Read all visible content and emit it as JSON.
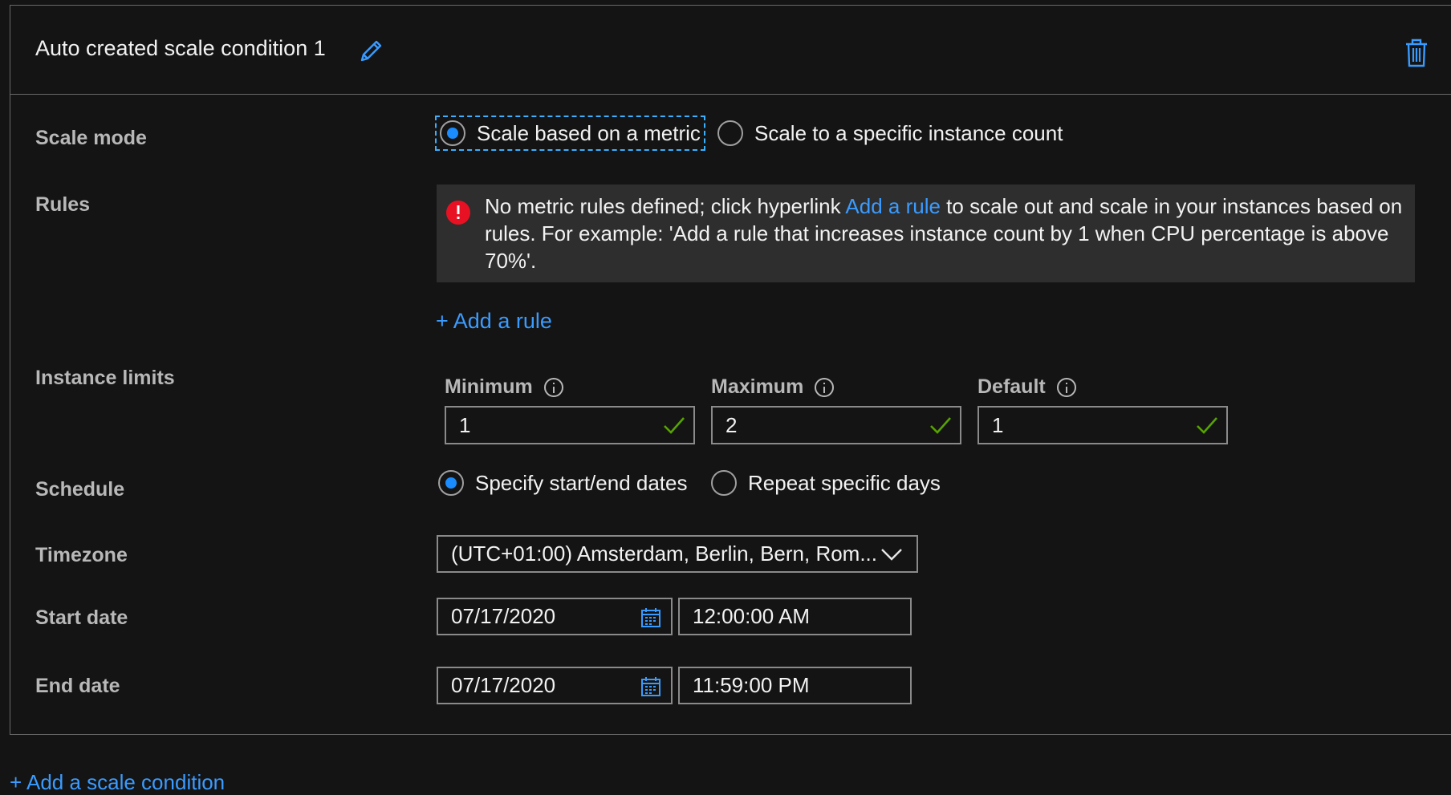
{
  "condition": {
    "title": "Auto created scale condition 1"
  },
  "labels": {
    "scale_mode": "Scale mode",
    "rules": "Rules",
    "instance_limits": "Instance limits",
    "schedule": "Schedule",
    "timezone": "Timezone",
    "start_date": "Start date",
    "end_date": "End date"
  },
  "scale_mode": {
    "option_metric": "Scale based on a metric",
    "option_count": "Scale to a specific instance count",
    "selected": "metric"
  },
  "rules": {
    "message_before": "No metric rules defined; click hyperlink ",
    "message_link": "Add a rule",
    "message_after": " to scale out and scale in your instances based on rules. For example: 'Add a rule that increases instance count by 1 when CPU percentage is above 70%'.",
    "add_rule_label": "+ Add a rule"
  },
  "limits": {
    "minimum_label": "Minimum",
    "minimum_value": "1",
    "maximum_label": "Maximum",
    "maximum_value": "2",
    "default_label": "Default",
    "default_value": "1"
  },
  "schedule": {
    "option_dates": "Specify start/end dates",
    "option_days": "Repeat specific days",
    "selected": "dates"
  },
  "timezone": {
    "value": "(UTC+01:00) Amsterdam, Berlin, Bern, Rom..."
  },
  "start": {
    "date": "07/17/2020",
    "time": "12:00:00 AM"
  },
  "end": {
    "date": "07/17/2020",
    "time": "11:59:00 PM"
  },
  "footer": {
    "add_condition_label": "+ Add a scale condition"
  },
  "colors": {
    "accent": "#3a9bff",
    "error": "#e81123",
    "valid": "#57a300",
    "background": "#141414"
  }
}
